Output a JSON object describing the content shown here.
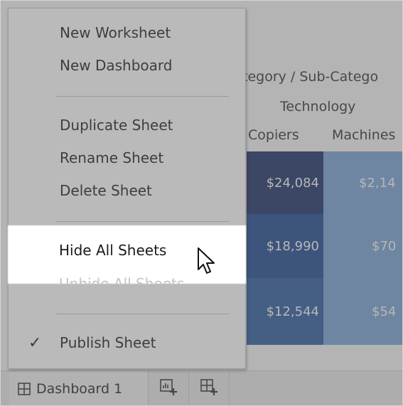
{
  "menu": {
    "items": [
      {
        "label": "New Worksheet"
      },
      {
        "label": "New Dashboard"
      },
      {
        "label": "Duplicate Sheet"
      },
      {
        "label": "Rename Sheet"
      },
      {
        "label": "Delete Sheet"
      },
      {
        "label": "Hide All Sheets"
      },
      {
        "label": "Unhide All Sheets"
      },
      {
        "label": "Publish Sheet",
        "checked": true
      }
    ],
    "check_glyph": "✓"
  },
  "worksheet": {
    "header_path": "tegory / Sub-Catego",
    "category": "Technology",
    "columns": [
      "Copiers",
      "Machines"
    ],
    "rows": [
      [
        "$24,084",
        "$2,14"
      ],
      [
        "$18,990",
        "$70"
      ],
      [
        "$12,544",
        "$54"
      ]
    ],
    "colors": {
      "copiers": [
        "#0a1f5c",
        "#0d3a8a",
        "#1a4f9a"
      ],
      "machines": [
        "#6f9fd6",
        "#6f9fd6",
        "#6f9fd6"
      ]
    }
  },
  "tabs": {
    "dashboard_label": "Dashboard 1",
    "dashboard_icon": "grid-icon",
    "new_worksheet_icon": "new-worksheet-icon",
    "new_dashboard_icon": "new-dashboard-icon"
  },
  "cursor_icon": "arrow-cursor-icon"
}
